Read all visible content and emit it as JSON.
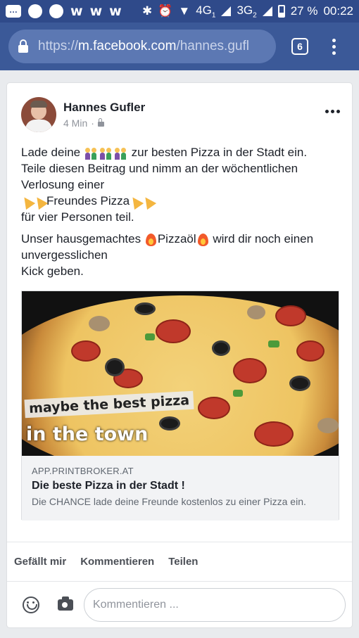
{
  "status_bar": {
    "w_letters": [
      "w",
      "w",
      "w"
    ],
    "network_1": "4G",
    "network_1_sub": "1",
    "network_2": "3G",
    "network_2_sub": "2",
    "battery": "27 %",
    "time": "00:22"
  },
  "browser": {
    "url_scheme": "https://",
    "url_host": "m.facebook.com",
    "url_path": "/hannes.gufl",
    "tab_count": "6"
  },
  "post": {
    "author": "Hannes Gufler",
    "time": "4 Min",
    "meta_separator": "·",
    "text": {
      "p1_a": "Lade deine",
      "p1_b": "zur besten Pizza in der Stadt ein.",
      "p1_c": "Teile diesen Beitrag und nimm an der wöchentlichen Verlosung einer",
      "p1_d": "Freundes Pizza",
      "p1_e": "für vier Personen teil.",
      "p2_a": "Unser hausgemachtes",
      "p2_b": "Pizzaöl",
      "p2_c": "wird dir noch einen unvergesslichen",
      "p2_d": "Kick geben."
    }
  },
  "link_preview": {
    "image_text_1": "maybe the best pizza",
    "image_text_2": "in the town",
    "domain": "APP.PRINTBROKER.AT",
    "title": "Die beste Pizza in der Stadt !",
    "description": "Die CHANCE lade deine Freunde kostenlos zu einer Pizza ein."
  },
  "actions": {
    "like": "Gefällt mir",
    "comment": "Kommentieren",
    "share": "Teilen"
  },
  "comment_box": {
    "placeholder": "Kommentieren ..."
  },
  "icons": {
    "status": [
      "message-icon",
      "circle-icon",
      "circle-icon",
      "bluetooth-icon",
      "alarm-icon",
      "wifi-icon",
      "signal-icon",
      "battery-icon"
    ],
    "browser": [
      "lock-icon",
      "tabs-icon",
      "more-vert-icon"
    ],
    "post": [
      "lock-icon",
      "more-horiz-icon",
      "people-holding-hands-emoji",
      "pizza-emoji",
      "fire-emoji",
      "smile-icon",
      "camera-icon"
    ]
  },
  "colors": {
    "status_bar": "#2f4a8a",
    "browser_bar": "#3b5998",
    "url_pill": "#5c78b3",
    "page_bg": "#e9ebee",
    "text": "#1d2129",
    "secondary_text": "#90949c"
  }
}
